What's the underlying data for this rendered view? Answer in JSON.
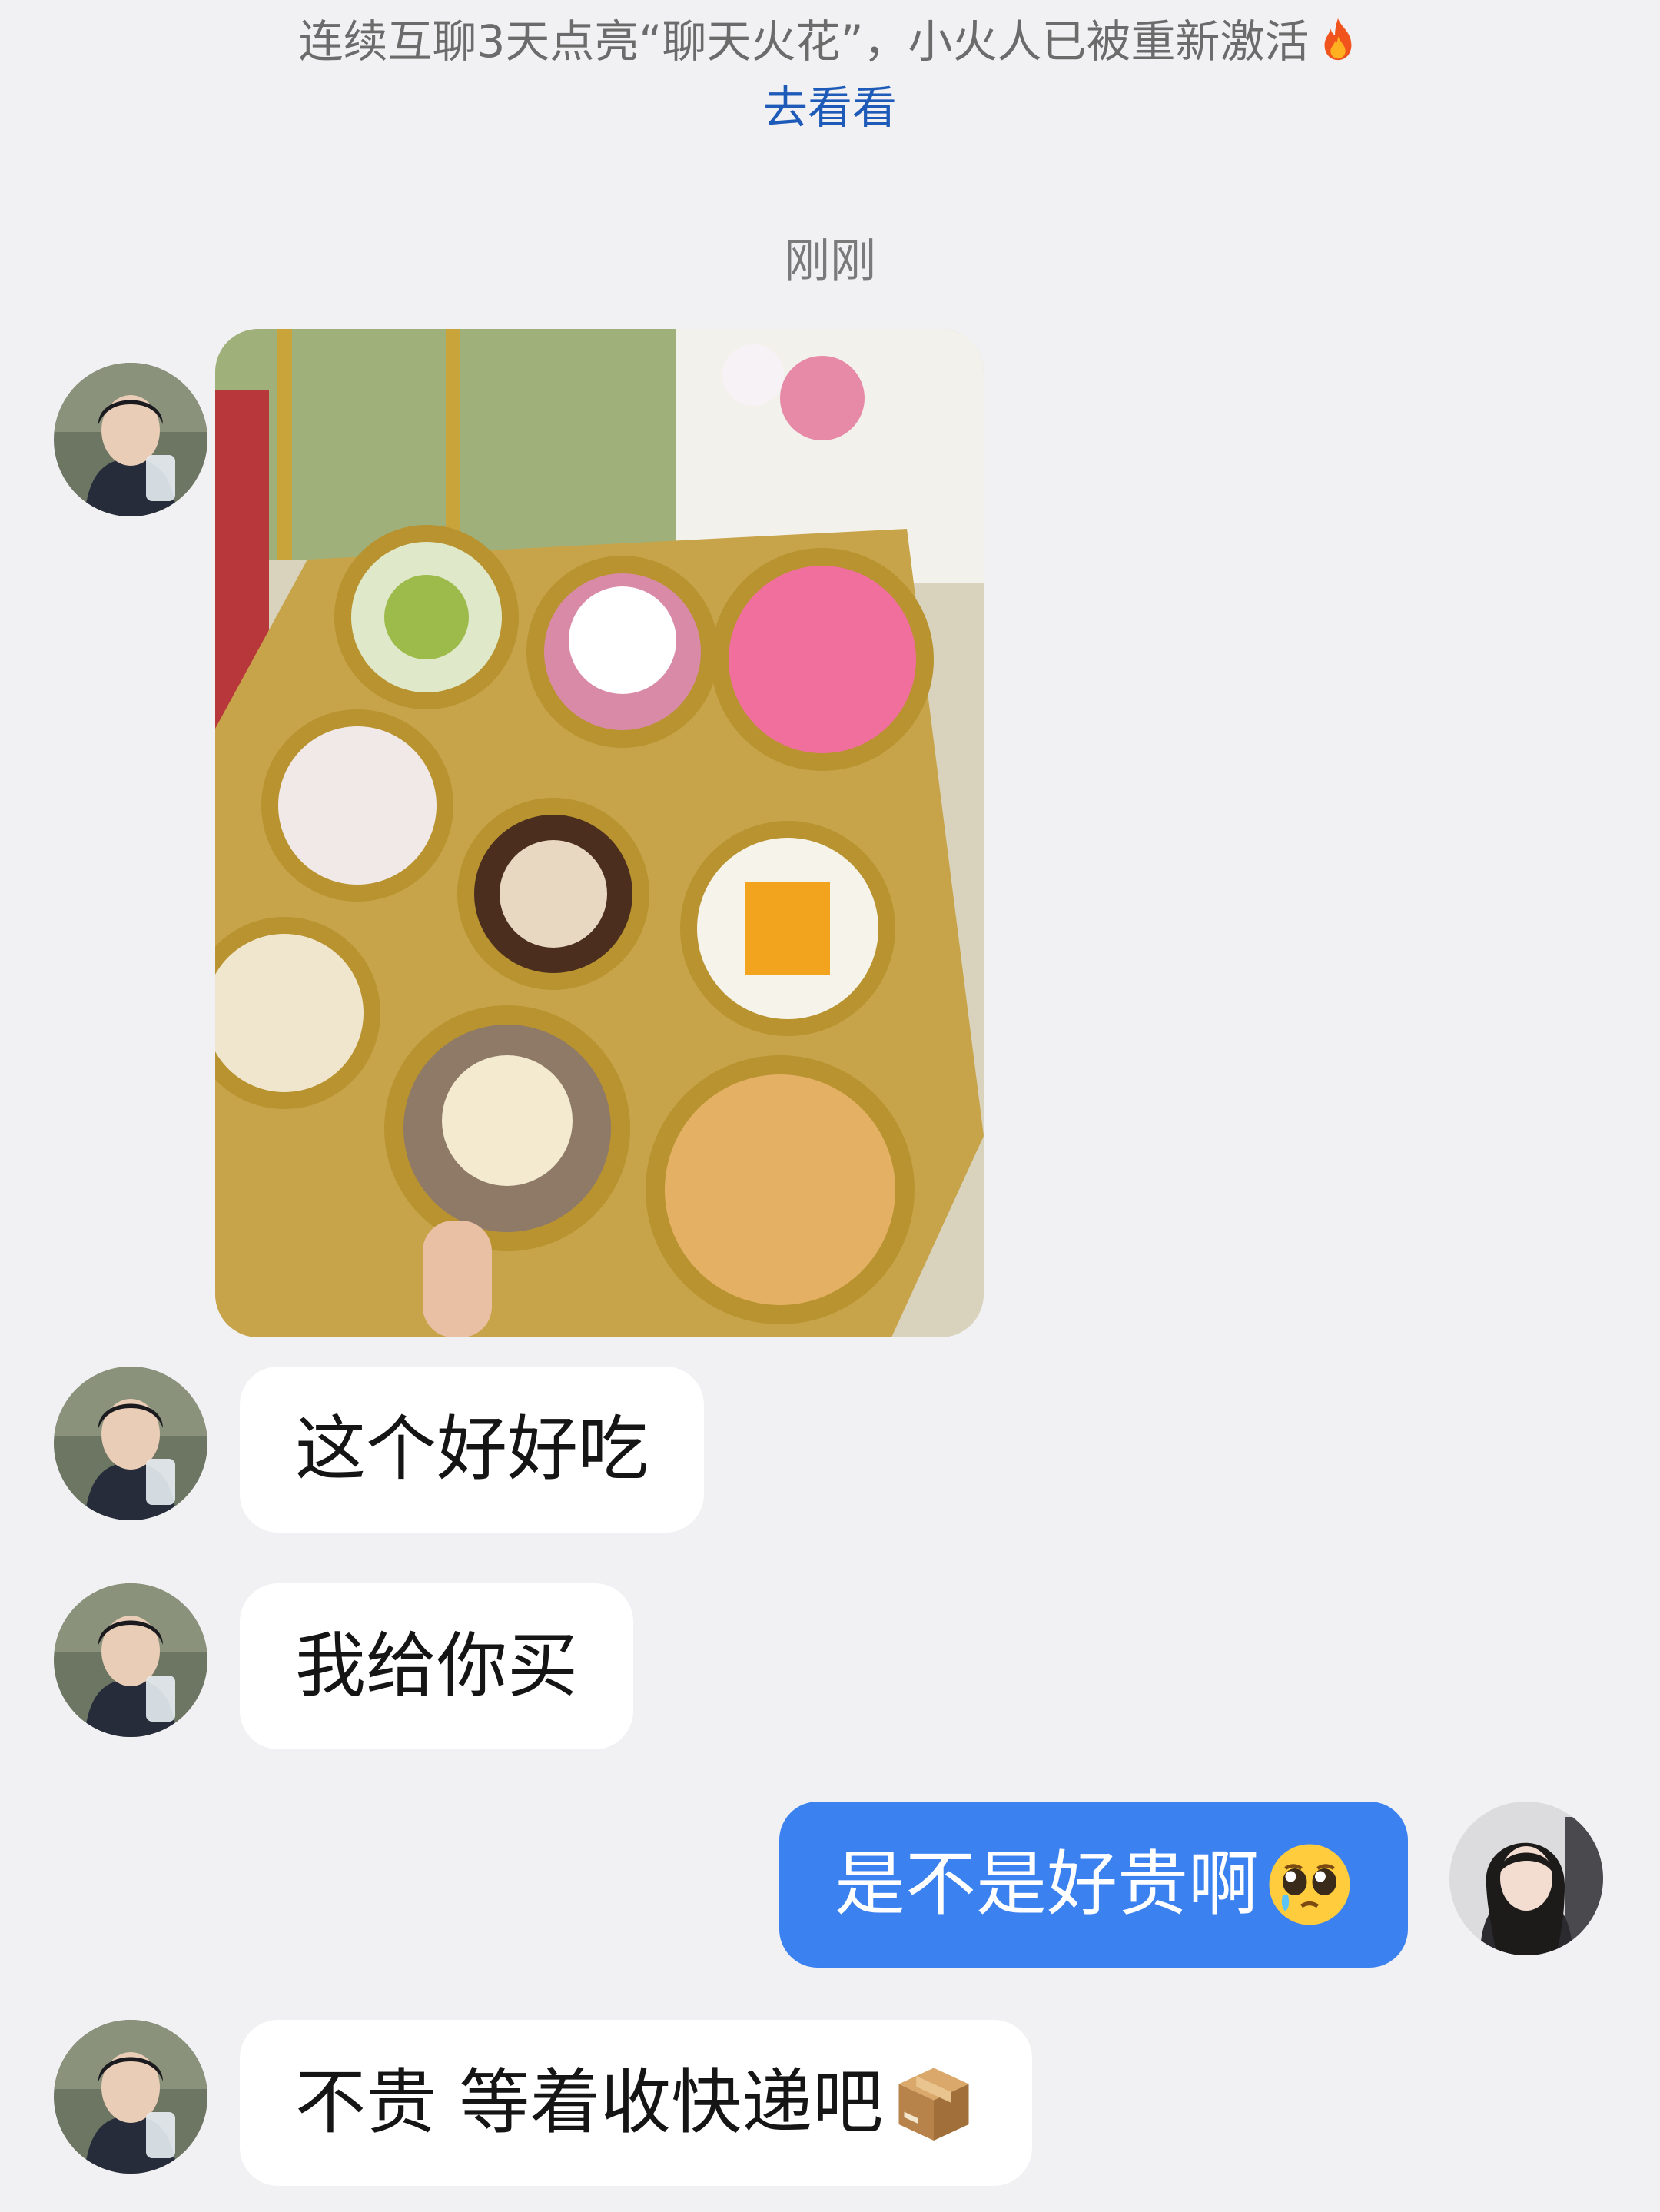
{
  "system": {
    "notice_text": "连续互聊3天点亮“聊天火花”，小火人已被重新激活",
    "notice_icon": "fire-icon",
    "link_label": "去看看",
    "timestamp": "刚刚"
  },
  "messages": [
    {
      "sender": "friend",
      "type": "image",
      "content": "cake-cups-photo"
    },
    {
      "sender": "friend",
      "type": "text",
      "text": "这个好好吃"
    },
    {
      "sender": "friend",
      "type": "text",
      "text": "我给你买"
    },
    {
      "sender": "me",
      "type": "text",
      "text": "是不是好贵啊",
      "emoji": "pleading-face-icon"
    },
    {
      "sender": "friend",
      "type": "text",
      "text": "不贵 等着收快递吧",
      "emoji": "package-icon"
    }
  ],
  "colors": {
    "background": "#f1f1f3",
    "incoming_bubble": "#ffffff",
    "outgoing_bubble": "#3b82f0",
    "link": "#1e5bb8"
  }
}
